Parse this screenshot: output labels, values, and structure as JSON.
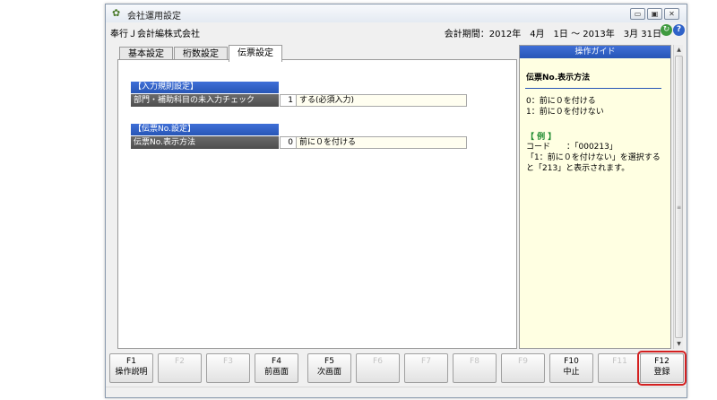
{
  "window": {
    "title": "会社運用設定",
    "controls": [
      "▭",
      "▣",
      "✕"
    ]
  },
  "info": {
    "company": "奉行Ｊ会計編株式会社",
    "period": "会計期間：2012年　4月　1日 〜 2013年　3月 31日",
    "refresh_glyph": "↻",
    "help_glyph": "?"
  },
  "tabs": [
    {
      "label": "基本設定",
      "active": false
    },
    {
      "label": "桁数設定",
      "active": false
    },
    {
      "label": "伝票設定",
      "active": true
    }
  ],
  "sections": [
    {
      "header": "【入力規則設定】",
      "field": {
        "label": "部門・補助科目の未入力チェック",
        "code": "1",
        "value": "する(必須入力)"
      }
    },
    {
      "header": "【伝票No.設定】",
      "field": {
        "label": "伝票No.表示方法",
        "code": "0",
        "value": "前に０を付ける"
      }
    }
  ],
  "guide": {
    "header": "操作ガイド",
    "title": "伝票No.表示方法",
    "options": [
      "0：前に０を付ける",
      "1：前に０を付けない"
    ],
    "example_label": "【 例 】",
    "code_line": "コード　　：「000213」",
    "explanation": "「1：前に０を付けない」を選択すると「213」と表示されます。"
  },
  "fkeys": [
    {
      "key": "F1",
      "label": "操作説明",
      "enabled": true
    },
    {
      "key": "F2",
      "label": "",
      "enabled": false
    },
    {
      "key": "F3",
      "label": "",
      "enabled": false
    },
    {
      "key": "F4",
      "label": "前画面",
      "enabled": true
    },
    {
      "key": "F5",
      "label": "次画面",
      "enabled": true
    },
    {
      "key": "F6",
      "label": "",
      "enabled": false
    },
    {
      "key": "F7",
      "label": "",
      "enabled": false
    },
    {
      "key": "F8",
      "label": "",
      "enabled": false
    },
    {
      "key": "F9",
      "label": "",
      "enabled": false
    },
    {
      "key": "F10",
      "label": "中止",
      "enabled": true
    },
    {
      "key": "F11",
      "label": "",
      "enabled": false
    },
    {
      "key": "F12",
      "label": "登録",
      "enabled": true,
      "highlighted": true
    }
  ],
  "colors": {
    "section_header": "#2756b6",
    "field_label": "#555555",
    "guide_background": "#ffffe2",
    "highlight": "#d42020"
  }
}
